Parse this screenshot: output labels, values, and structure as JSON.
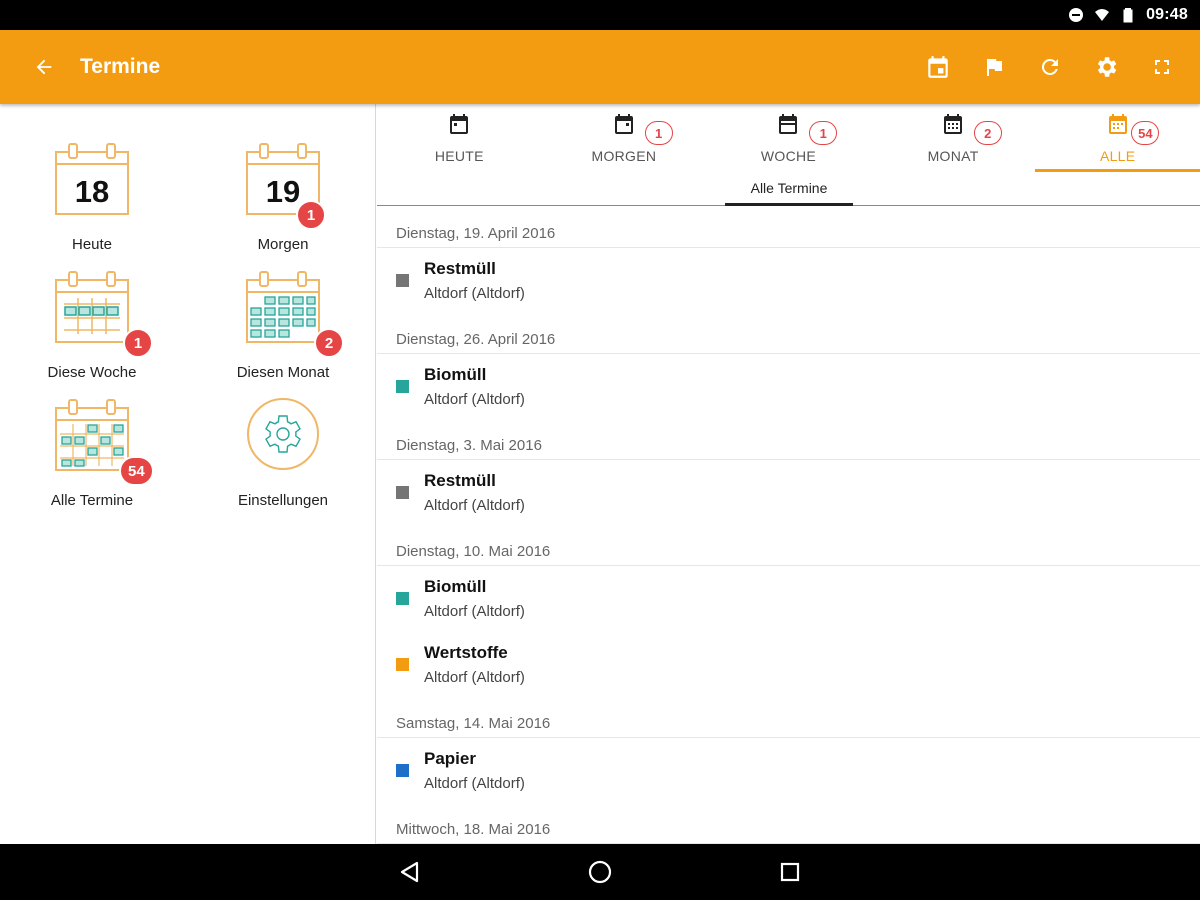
{
  "statusbar": {
    "time": "09:48"
  },
  "appbar": {
    "title": "Termine",
    "actions": [
      "calendar-event-icon",
      "flag-icon",
      "refresh-icon",
      "settings-icon",
      "fullscreen-icon"
    ]
  },
  "sidebar": {
    "tiles": [
      {
        "label": "Heute",
        "day": "18",
        "badge": ""
      },
      {
        "label": "Morgen",
        "day": "19",
        "badge": "1"
      },
      {
        "label": "Diese Woche",
        "badge": "1"
      },
      {
        "label": "Diesen Monat",
        "badge": "2"
      },
      {
        "label": "Alle Termine",
        "badge": "54"
      },
      {
        "label": "Einstellungen",
        "badge": ""
      }
    ]
  },
  "tabs": [
    {
      "label": "HEUTE",
      "count": ""
    },
    {
      "label": "MORGEN",
      "count": "1"
    },
    {
      "label": "WOCHE",
      "count": "1"
    },
    {
      "label": "MONAT",
      "count": "2"
    },
    {
      "label": "ALLE",
      "count": "54"
    }
  ],
  "subtab": {
    "label": "Alle Termine"
  },
  "colors": {
    "accent": "#f39c12",
    "badge": "#e64545",
    "restmuell": "#757575",
    "biomuell": "#26a69a",
    "wertstoffe": "#f39c12",
    "papier": "#1e6fc8"
  },
  "groups": [
    {
      "date": "Dienstag, 19. April 2016",
      "items": [
        {
          "name": "Restmüll",
          "place": "Altdorf (Altdorf)",
          "color": "#757575"
        }
      ]
    },
    {
      "date": "Dienstag, 26. April 2016",
      "items": [
        {
          "name": "Biomüll",
          "place": "Altdorf (Altdorf)",
          "color": "#26a69a"
        }
      ]
    },
    {
      "date": "Dienstag, 3. Mai 2016",
      "items": [
        {
          "name": "Restmüll",
          "place": "Altdorf (Altdorf)",
          "color": "#757575"
        }
      ]
    },
    {
      "date": "Dienstag, 10. Mai 2016",
      "items": [
        {
          "name": "Biomüll",
          "place": "Altdorf (Altdorf)",
          "color": "#26a69a"
        },
        {
          "name": "Wertstoffe",
          "place": "Altdorf (Altdorf)",
          "color": "#f39c12"
        }
      ]
    },
    {
      "date": "Samstag, 14. Mai 2016",
      "items": [
        {
          "name": "Papier",
          "place": "Altdorf (Altdorf)",
          "color": "#1e6fc8"
        }
      ]
    },
    {
      "date": "Mittwoch, 18. Mai 2016",
      "items": []
    }
  ]
}
